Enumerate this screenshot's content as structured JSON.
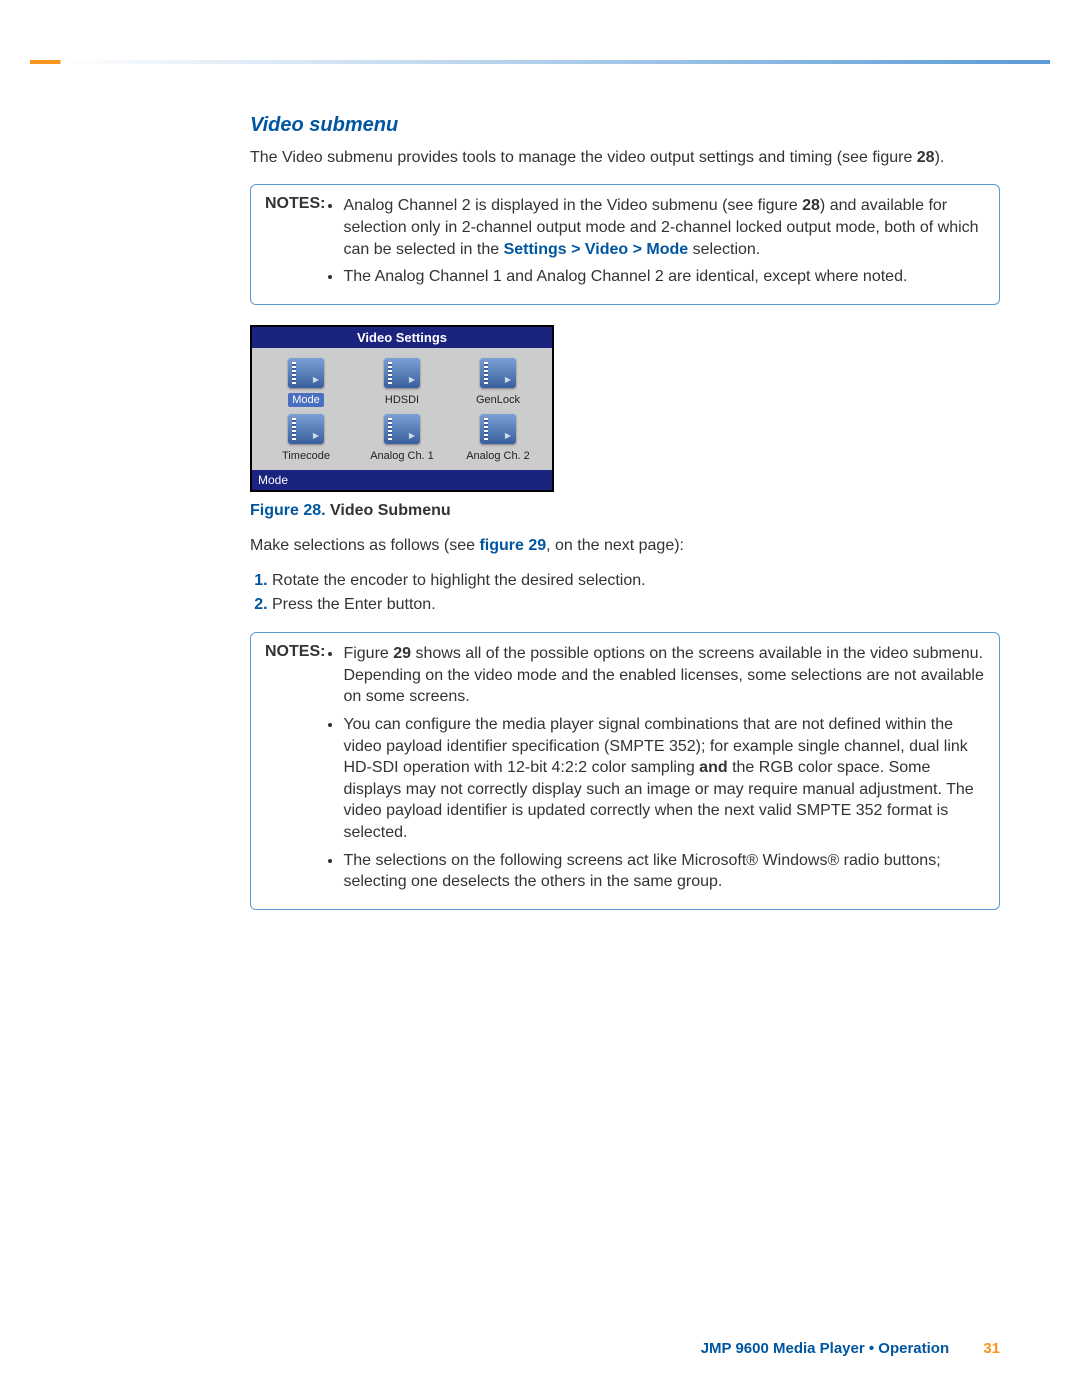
{
  "heading": "Video submenu",
  "intro_a": "The Video submenu provides tools to manage the video output settings and timing (see figure ",
  "intro_fig": "28",
  "intro_b": ").",
  "notes_label": "NOTES:",
  "notes1": {
    "item1_a": "Analog Channel 2 is displayed in the Video submenu (see figure ",
    "item1_fig": "28",
    "item1_b": ") and available for selection only in 2-channel output mode and 2-channel locked output mode, both of which can be selected in the ",
    "item1_link": "Settings > Video > Mode",
    "item1_c": " selection.",
    "item2": "The Analog Channel 1 and Analog Channel 2 are identical, except where noted."
  },
  "screenshot": {
    "title": "Video Settings",
    "icons": [
      "Mode",
      "HDSDI",
      "GenLock",
      "Timecode",
      "Analog Ch. 1",
      "Analog Ch. 2"
    ],
    "footer": "Mode"
  },
  "caption_prefix": "Figure 28.",
  "caption_text": " Video Submenu",
  "make_a": "Make selections as follows (see ",
  "make_link": "figure 29",
  "make_b": ", on the next page):",
  "steps": {
    "s1": "Rotate the encoder to highlight the desired selection.",
    "s2": "Press the Enter button."
  },
  "notes2": {
    "item1_a": "Figure ",
    "item1_fig": "29",
    "item1_b": " shows all of the possible options on the screens available in the video submenu. Depending on the video mode and the enabled licenses, some selections are not available on some screens.",
    "item2_a": "You can configure the media player signal combinations that are not defined within the video payload identifier specification (SMPTE 352); for example single channel, dual link HD-SDI operation with 12-bit 4:2:2 color sampling ",
    "item2_and": "and",
    "item2_b": " the RGB color space. Some displays may not correctly display such an image or may require manual adjustment. The video payload identifier is updated correctly when the next valid SMPTE 352 format is selected.",
    "item3": "The selections on the following screens act like Microsoft® Windows® radio buttons; selecting one deselects the others in the same group."
  },
  "footer_title": "JMP 9600 Media Player • Operation",
  "footer_page": "31"
}
